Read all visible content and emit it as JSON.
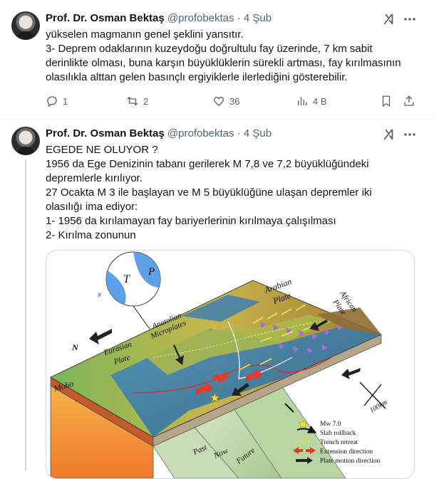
{
  "tweet1": {
    "author_name": "Prof. Dr. Osman Bektaş",
    "author_handle": "@profobektas",
    "separator": "·",
    "time": "4 Şub",
    "lines": [
      "yükselen magmanın genel şeklini yansıtır.",
      "3- Deprem odaklarının kuzeydoğu doğrultulu fay üzerinde, 7 km sabit",
      "derinlikte olması, buna karşın büyüklüklerin sürekli artması, fay kırılmasının",
      "olasılıkla alttan gelen basınçlı ergiyiklerle ilerlediğini gösterebilir."
    ],
    "replies": "1",
    "reposts": "2",
    "likes": "36",
    "views": "4 B"
  },
  "tweet2": {
    "author_name": "Prof. Dr. Osman Bektaş",
    "author_handle": "@profobektas",
    "separator": "·",
    "time": "4 Şub",
    "lines": [
      "EGEDE NE OLUYOR ?",
      "1956 da Ege Denizinin tabanı gerilerek M 7,8 ve 7,2 büyüklüğündeki",
      "depremlerle kırılıyor.",
      "27 Ocakta M 3 ile başlayan ve M 5 büyüklüğüne ulaşan depremler iki",
      "olasılığı ima ediyor:",
      "1- 1956 da kırılamayan fay bariyerlerinin kırılmaya çalışılması",
      "2- Kırılma zonunun"
    ]
  },
  "figure": {
    "beachball_t": "T",
    "beachball_p": "P",
    "beachball_n": "N",
    "north": "N",
    "moho": "Moho",
    "eurasian": "Eurasian",
    "plate1": "Plate",
    "anatolian": "Anatolian",
    "micro": "Microplates",
    "arabian": "Arabian",
    "plate2": "Plate",
    "african": "African",
    "plate3": "Plate",
    "scale": "100km",
    "past": "Past",
    "now": "Now",
    "future": "Future",
    "legend": [
      "Mw 7.0",
      "Slab rollback",
      "Trench retreat",
      "Extension direction",
      "Plate motion direction"
    ]
  },
  "colors": {
    "text_primary": "#0f1419",
    "text_secondary": "#536471",
    "divider": "#eff3f4"
  },
  "icons": [
    "grok-icon",
    "more-icon",
    "reply-icon",
    "repost-icon",
    "like-icon",
    "views-icon",
    "bookmark-icon",
    "share-icon"
  ]
}
